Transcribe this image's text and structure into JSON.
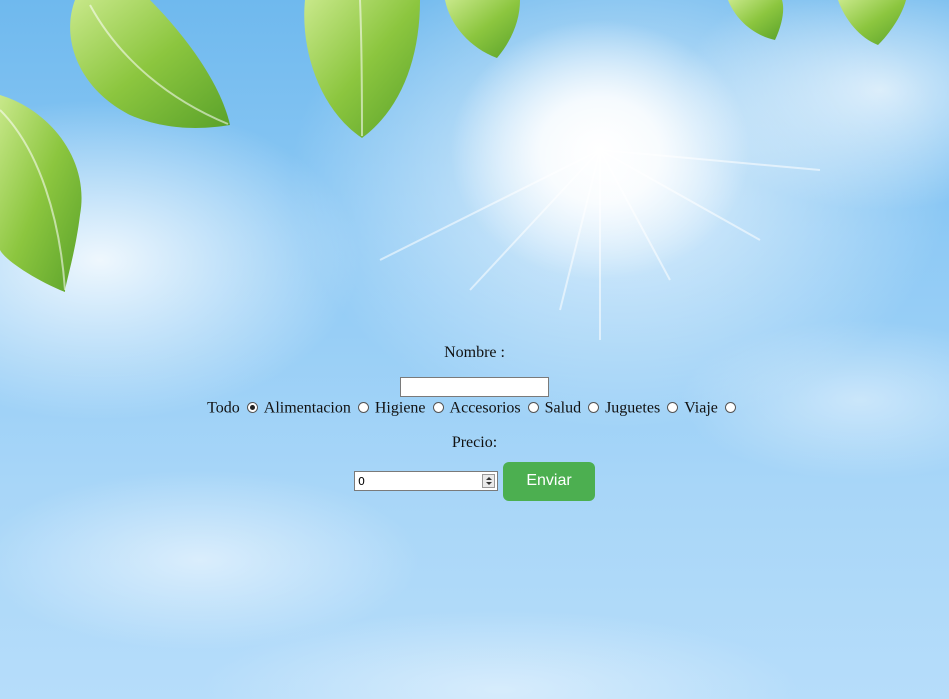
{
  "form": {
    "name_label": "Nombre :",
    "name_value": "",
    "categories": [
      {
        "label": "Todo",
        "selected": true
      },
      {
        "label": "Alimentacion",
        "selected": false
      },
      {
        "label": "Higiene",
        "selected": false
      },
      {
        "label": "Accesorios",
        "selected": false
      },
      {
        "label": "Salud",
        "selected": false
      },
      {
        "label": "Juguetes",
        "selected": false
      },
      {
        "label": "Viaje",
        "selected": false
      }
    ],
    "price_label": "Precio:",
    "price_value": "0",
    "submit_label": "Enviar"
  },
  "colors": {
    "submit_button": "#4caf50",
    "sky": "#8fcaf5",
    "leaf": "#8cc63f"
  }
}
